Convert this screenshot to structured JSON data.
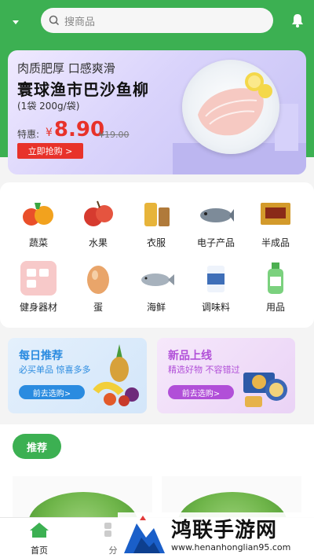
{
  "header": {
    "search_placeholder": "搜商品",
    "icons": [
      "location-dropdown-icon",
      "search-icon",
      "bell-icon"
    ]
  },
  "banner": {
    "subtitle": "肉质肥厚 口感爽滑",
    "title": "寰球渔市巴沙鱼柳",
    "spec": "(1袋 200g/袋)",
    "price_label": "特惠:",
    "currency": "¥",
    "price": "8.90",
    "old_price": "¥19.00",
    "buy_button": "立即抢购 >"
  },
  "categories": [
    {
      "label": "蔬菜",
      "icon": "vegetable-icon",
      "color": "#e94f2a"
    },
    {
      "label": "水果",
      "icon": "fruit-icon",
      "color": "#d63b2f"
    },
    {
      "label": "衣服",
      "icon": "clothes-icon",
      "color": "#e7b43a"
    },
    {
      "label": "电子产品",
      "icon": "electronics-icon",
      "color": "#7d8b99"
    },
    {
      "label": "半成品",
      "icon": "semi-finished-icon",
      "color": "#c9662b"
    },
    {
      "label": "健身器材",
      "icon": "fitness-icon",
      "color": "#f7c9c9"
    },
    {
      "label": "蛋",
      "icon": "egg-icon",
      "color": "#e9a56a"
    },
    {
      "label": "海鲜",
      "icon": "seafood-icon",
      "color": "#a7b2bd"
    },
    {
      "label": "调味料",
      "icon": "seasoning-icon",
      "color": "#3f6fb8"
    },
    {
      "label": "用品",
      "icon": "detergent-icon",
      "color": "#4caf50"
    }
  ],
  "promos": {
    "daily": {
      "title": "每日推荐",
      "subtitle": "必买单品 惊喜多多",
      "button": "前去选购>"
    },
    "new": {
      "title": "新品上线",
      "subtitle": "精选好物 不容错过",
      "button": "前去选购>"
    }
  },
  "recommend": {
    "tag": "推荐"
  },
  "tabbar": {
    "home": "首页",
    "category": "分"
  },
  "watermark": {
    "name": "鸿联手游网",
    "url": "www.henanhonglian95.com"
  },
  "colors": {
    "brand_green": "#3cb052",
    "price_red": "#e8322a",
    "daily_blue": "#2a8be0",
    "new_purple": "#b14fd8"
  }
}
